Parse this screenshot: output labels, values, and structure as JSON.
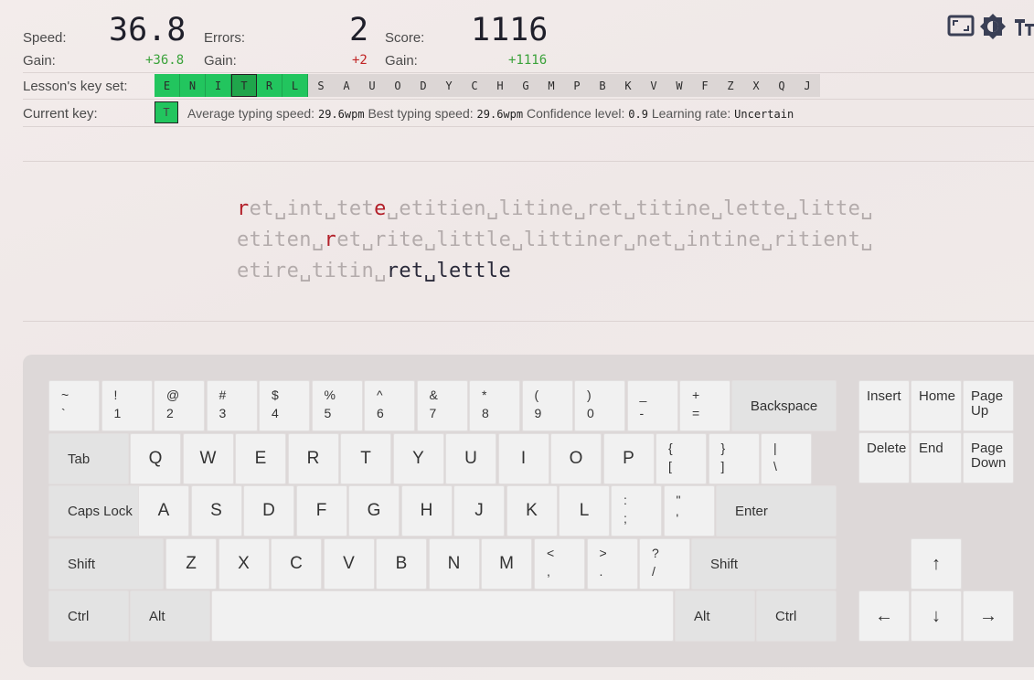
{
  "stats": {
    "speed_label": "Speed:",
    "speed_value": "36.8",
    "speed_gain_label": "Gain:",
    "speed_gain": "+36.8",
    "errors_label": "Errors:",
    "errors_value": "2",
    "errors_gain_label": "Gain:",
    "errors_gain": "+2",
    "score_label": "Score:",
    "score_value": "1116",
    "score_gain_label": "Gain:",
    "score_gain": "+1116"
  },
  "keyset": {
    "label": "Lesson's key set:",
    "keys": [
      "E",
      "N",
      "I",
      "T",
      "R",
      "L",
      "S",
      "A",
      "U",
      "O",
      "D",
      "Y",
      "C",
      "H",
      "G",
      "M",
      "P",
      "B",
      "K",
      "V",
      "W",
      "F",
      "Z",
      "X",
      "Q",
      "J"
    ],
    "included_count": 6,
    "current_index": 3
  },
  "current": {
    "label": "Current key:",
    "key": "T",
    "avg_label": "Average typing speed:",
    "avg_value": "29.6wpm",
    "best_label": "Best typing speed:",
    "best_value": "29.6wpm",
    "confidence_label": "Confidence level:",
    "confidence_value": "0.9",
    "rate_label": "Learning rate:",
    "rate_value": "Uncertain"
  },
  "text": {
    "line1": [
      {
        "t": "r",
        "s": "err"
      },
      {
        "t": "et␣int␣tet",
        "s": "pending"
      },
      {
        "t": "e",
        "s": "err"
      },
      {
        "t": "␣etitien␣litine␣ret␣titine␣lette␣litte␣",
        "s": "pending"
      }
    ],
    "line2": [
      {
        "t": "etiten␣",
        "s": "pending"
      },
      {
        "t": "r",
        "s": "err"
      },
      {
        "t": "et␣rite␣little␣littiner␣net␣intine␣ritient␣",
        "s": "pending"
      }
    ],
    "line3": [
      {
        "t": "etire␣titin␣",
        "s": "pending"
      },
      {
        "t": "ret␣lettle",
        "s": "done"
      }
    ]
  },
  "keyboard": {
    "row1": [
      [
        "~",
        "`"
      ],
      [
        "!",
        "1"
      ],
      [
        "@",
        "2"
      ],
      [
        "#",
        "3"
      ],
      [
        "$",
        "4"
      ],
      [
        "%",
        "5"
      ],
      [
        "^",
        "6"
      ],
      [
        "&",
        "7"
      ],
      [
        "*",
        "8"
      ],
      [
        "(",
        "9"
      ],
      [
        ")",
        "0"
      ],
      [
        "_",
        "-"
      ],
      [
        "+",
        "="
      ]
    ],
    "backspace": "Backspace",
    "tab": "Tab",
    "row2": [
      "Q",
      "W",
      "E",
      "R",
      "T",
      "Y",
      "U",
      "I",
      "O",
      "P"
    ],
    "row2_sym": [
      [
        "{",
        "["
      ],
      [
        "}",
        "]"
      ],
      [
        "|",
        "\\"
      ]
    ],
    "caps": "Caps Lock",
    "row3": [
      "A",
      "S",
      "D",
      "F",
      "G",
      "H",
      "J",
      "K",
      "L"
    ],
    "row3_sym": [
      [
        ":",
        ";"
      ],
      [
        "\"",
        "'"
      ]
    ],
    "enter": "Enter",
    "shift_l": "Shift",
    "row4": [
      "Z",
      "X",
      "C",
      "V",
      "B",
      "N",
      "M"
    ],
    "row4_sym": [
      [
        "<",
        ","
      ],
      [
        ">",
        "."
      ],
      [
        "?",
        "/"
      ]
    ],
    "shift_r": "Shift",
    "ctrl_l": "Ctrl",
    "alt_l": "Alt",
    "alt_r": "Alt",
    "ctrl_r": "Ctrl",
    "insert": "Insert",
    "home": "Home",
    "page_up": "Page\nUp",
    "delete": "Delete",
    "end": "End",
    "page_down": "Page\nDown",
    "arrow_up": "↑",
    "arrow_left": "←",
    "arrow_down": "↓",
    "arrow_right": "→"
  },
  "icons": [
    "fullscreen-icon",
    "theme-icon",
    "font-size-icon"
  ]
}
